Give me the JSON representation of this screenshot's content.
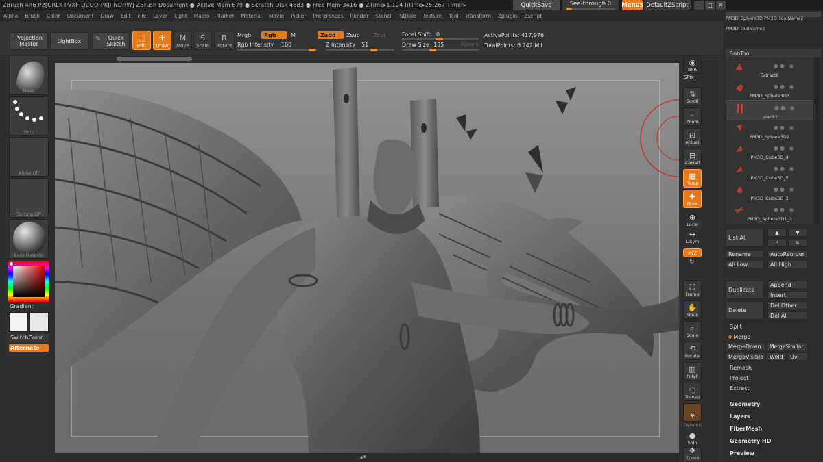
{
  "titlebar": {
    "app": "ZBrush 4R6 P2[GRLK-PVXF-QCOQ-PKJI-NDHW]   ZBrush Document     ● Active Mem 679 ● Scratch Disk 4883 ● Free Mem 3416 ● ZTime▸1.124 RTime▸25.267 Timer▸",
    "quicksave": "QuickSave",
    "seethrough": "See-through  0",
    "menus": "Menus",
    "defaultscript": "DefaultZScript",
    "win_min": "–",
    "win_max": "□",
    "win_close": "✕"
  },
  "menubar": [
    "Alpha",
    "Brush",
    "Color",
    "Document",
    "Draw",
    "Edit",
    "File",
    "Layer",
    "Light",
    "Macro",
    "Marker",
    "Material",
    "Movie",
    "Picker",
    "Preferences",
    "Render",
    "Stencil",
    "Stroke",
    "Texture",
    "Tool",
    "Transform",
    "Zplugin",
    "Zscript"
  ],
  "shelf": {
    "projection_master": "Projection Master",
    "lightbox": "LightBox",
    "quick_sketch": "Quick Sketch",
    "edit": "Edit",
    "draw": "Draw",
    "move": "Move",
    "scale": "Scale",
    "rotate": "Rotate",
    "mrgb": "Mrgb",
    "rgb": "Rgb",
    "m": "M",
    "zadd": "Zadd",
    "zsub": "Zsub",
    "zcut": "Zcut",
    "rgb_intensity_label": "Rgb Intensity",
    "rgb_intensity": "100",
    "z_intensity_label": "Z Intensity",
    "z_intensity": "51",
    "focal_shift_label": "Focal Shift",
    "focal_shift": "0",
    "draw_size_label": "Draw Size",
    "draw_size": "135",
    "dynamic": "Dynamic",
    "active_points": "ActivePoints: 417,976",
    "total_points": "TotalPoints: 6.242 Mil"
  },
  "left_tray": {
    "brush": "Move",
    "stroke": "Dots",
    "alpha": "Alpha Off",
    "texture": "Texture Off",
    "material": "BasicMaterial",
    "gradient": "Gradient",
    "switchcolor": "SwitchColor",
    "alternate": "Alternate"
  },
  "right_tray": {
    "bpr": "BPR",
    "spix": "SPix",
    "scroll": "Scroll",
    "zoom": "Zoom",
    "actual": "Actual",
    "aahalf": "AAHalf",
    "persp": "Persp",
    "floor": "Floor",
    "local": "Local",
    "lsym": "L.Sym",
    "xyz": "XYZ",
    "frame": "Frame",
    "move": "Move",
    "scale": "Scale",
    "rotate": "Rotate",
    "polyf": "PolyF",
    "transp": "Transp",
    "dynamic": "Dynamic",
    "solo": "Solo",
    "xpose": "Xpose"
  },
  "tool_panel": {
    "tool_name_1": "PM3D_Sphere3D·PM3D_toolName2",
    "tool_name_2": "PM3D_toolName2",
    "subtool_header": "SubTool",
    "subtools": [
      "Extract8",
      "PM3D_Sphere3D3",
      "plank1",
      "PM3D_Sphere3D2",
      "PM3D_Cube3D_4",
      "PM3D_Cube3D_5",
      "PM3D_Cube3D_3",
      "PM3D_Sphere3D1_3"
    ],
    "selected_subtool": "plank1",
    "list_all": "List All",
    "rename": "Rename",
    "auto_reorder": "AutoReorder",
    "all_low": "All Low",
    "all_high": "All High",
    "duplicate": "Duplicate",
    "append": "Append",
    "insert": "Insert",
    "delete": "Delete",
    "del_other": "Del Other",
    "del_all": "Del All",
    "split": "Split",
    "merge": "Merge",
    "merge_down": "MergeDown",
    "merge_similar": "MergeSimilar",
    "merge_visible": "MergeVisible",
    "weld": "Weld",
    "uv": "Uv",
    "remesh": "Remesh",
    "project": "Project",
    "extract": "Extract",
    "geometry": "Geometry",
    "layers": "Layers",
    "fibermesh": "FiberMesh",
    "geometry_hd": "Geometry HD",
    "preview": "Preview"
  },
  "colors": {
    "accent": "#e8791a",
    "panel": "#303030",
    "canvas_top": "#939393",
    "canvas_bottom": "#6b6b6b"
  }
}
